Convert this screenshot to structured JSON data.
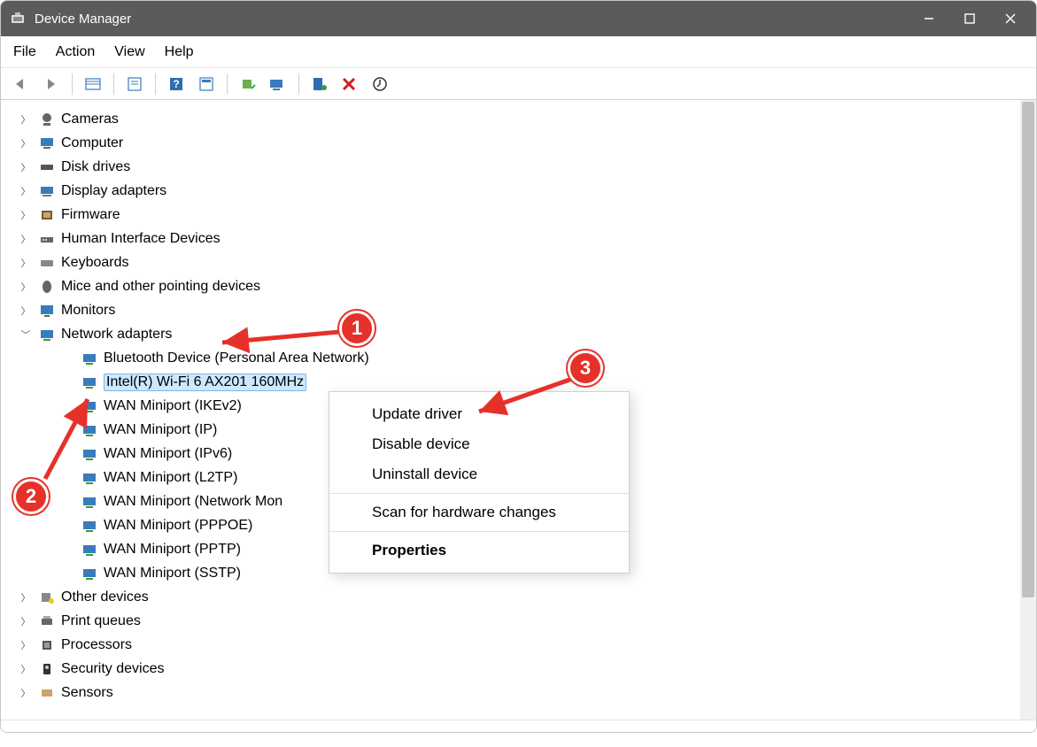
{
  "window": {
    "title": "Device Manager"
  },
  "menu": {
    "file": "File",
    "action": "Action",
    "view": "View",
    "help": "Help"
  },
  "tree": {
    "cameras": "Cameras",
    "computer": "Computer",
    "disk_drives": "Disk drives",
    "display_adapters": "Display adapters",
    "firmware": "Firmware",
    "hid": "Human Interface Devices",
    "keyboards": "Keyboards",
    "mice": "Mice and other pointing devices",
    "monitors": "Monitors",
    "network_adapters": "Network adapters",
    "na_children": [
      "Bluetooth Device (Personal Area Network)",
      "Intel(R) Wi-Fi 6 AX201 160MHz",
      "WAN Miniport (IKEv2)",
      "WAN Miniport (IP)",
      "WAN Miniport (IPv6)",
      "WAN Miniport (L2TP)",
      "WAN Miniport (Network Mon",
      "WAN Miniport (PPPOE)",
      "WAN Miniport (PPTP)",
      "WAN Miniport (SSTP)"
    ],
    "other_devices": "Other devices",
    "print_queues": "Print queues",
    "processors": "Processors",
    "security_devices": "Security devices",
    "sensors": "Sensors"
  },
  "context_menu": {
    "update_driver": "Update driver",
    "disable_device": "Disable device",
    "uninstall_device": "Uninstall device",
    "scan_hardware": "Scan for hardware changes",
    "properties": "Properties"
  },
  "callouts": {
    "one": "1",
    "two": "2",
    "three": "3"
  }
}
